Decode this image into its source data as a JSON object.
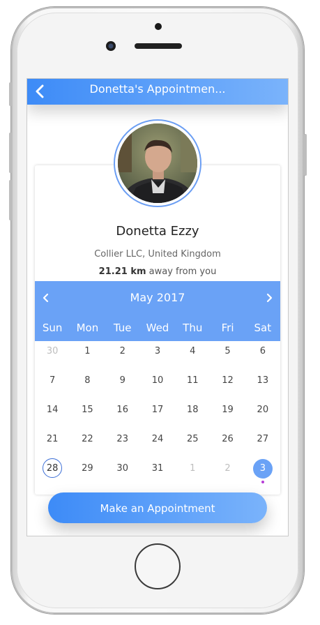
{
  "header": {
    "title": "Donetta's Appointmen..."
  },
  "profile": {
    "name": "Donetta Ezzy",
    "company": "Collier LLC, United Kingdom",
    "distance_value": "21.21 km",
    "distance_suffix": " away from you"
  },
  "calendar": {
    "month": "May 2017",
    "weekdays": [
      "Sun",
      "Mon",
      "Tue",
      "Wed",
      "Thu",
      "Fri",
      "Sat"
    ],
    "weeks": [
      [
        "30",
        "1",
        "2",
        "3",
        "4",
        "5",
        "6"
      ],
      [
        "7",
        "8",
        "9",
        "10",
        "11",
        "12",
        "13"
      ],
      [
        "14",
        "15",
        "16",
        "17",
        "18",
        "19",
        "20"
      ],
      [
        "21",
        "22",
        "23",
        "24",
        "25",
        "26",
        "27"
      ],
      [
        "28",
        "29",
        "30",
        "31",
        "1",
        "2",
        "3"
      ]
    ],
    "today": "28",
    "selected": "3"
  },
  "cta": {
    "label": "Make an Appointment"
  },
  "colors": {
    "accent": "#6aa2f6",
    "gradient_start": "#3d8bf7",
    "gradient_end": "#7ab3fb",
    "event_dot": "#b63bd6"
  },
  "icons": {
    "back": "chevron-left-icon",
    "prev": "chevron-left-icon",
    "next": "chevron-right-icon"
  }
}
